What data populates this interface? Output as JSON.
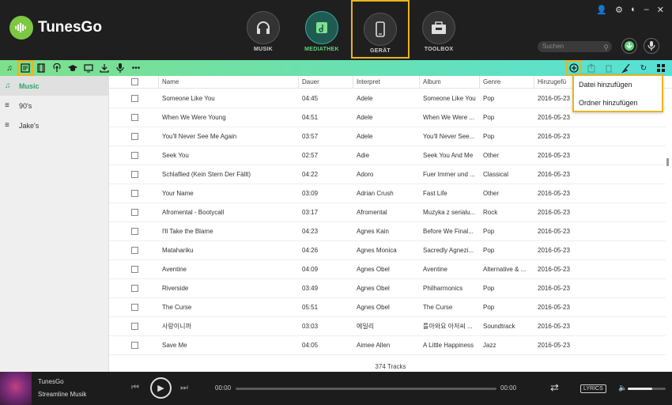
{
  "app": {
    "name": "TunesGo"
  },
  "window_controls": {
    "user": "👤",
    "settings": "⚙",
    "toggle": "◐",
    "minimize": "–",
    "close": "✕"
  },
  "nav_tabs": [
    {
      "label": "MUSIK"
    },
    {
      "label": "MEDIATHEK"
    },
    {
      "label": "GERÄT"
    },
    {
      "label": "TOOLBOX"
    }
  ],
  "search": {
    "placeholder": "Suchen"
  },
  "sidebar": {
    "items": [
      {
        "label": "Music"
      },
      {
        "label": "90's"
      },
      {
        "label": "Jake's"
      }
    ]
  },
  "table": {
    "headers": [
      "Name",
      "Dauer",
      "Interpret",
      "Album",
      "Genre",
      "Hinzugefü"
    ],
    "rows": [
      {
        "name": "Someone Like You",
        "duration": "04:45",
        "artist": "Adele",
        "album": "Someone Like You",
        "genre": "Pop",
        "added": "2016-05-23"
      },
      {
        "name": "When We Were Young",
        "duration": "04:51",
        "artist": "Adele",
        "album": "When We Were ...",
        "genre": "Pop",
        "added": "2016-05-23"
      },
      {
        "name": "You'll Never See Me Again",
        "duration": "03:57",
        "artist": "Adele",
        "album": "You'll Never See...",
        "genre": "Pop",
        "added": "2016-05-23"
      },
      {
        "name": "Seek You",
        "duration": "02:57",
        "artist": "Adie",
        "album": "Seek You And Me",
        "genre": "Other",
        "added": "2016-05-23"
      },
      {
        "name": "Schlaflied (Kein Stern Der Fällt)",
        "duration": "04:22",
        "artist": "Adoro",
        "album": "Fuer Immer und ...",
        "genre": "Classical",
        "added": "2016-05-23"
      },
      {
        "name": "Your Name",
        "duration": "03:09",
        "artist": "Adrian Crush",
        "album": "Fast Life",
        "genre": "Other",
        "added": "2016-05-23"
      },
      {
        "name": "Afromental - Bootycall",
        "duration": "03:17",
        "artist": "Afromental",
        "album": "Muzyka z serialu...",
        "genre": "Rock",
        "added": "2016-05-23"
      },
      {
        "name": "I'll Take the Blame",
        "duration": "04:23",
        "artist": "Agnes Kain",
        "album": "Before We Final...",
        "genre": "Pop",
        "added": "2016-05-23"
      },
      {
        "name": "Matahariku",
        "duration": "04:26",
        "artist": "Agnes Monica",
        "album": "Sacredly Agnezi...",
        "genre": "Pop",
        "added": "2016-05-23"
      },
      {
        "name": "Aventine",
        "duration": "04:09",
        "artist": "Agnes Obel",
        "album": "Aventine",
        "genre": "Alternative & ...",
        "added": "2016-05-23"
      },
      {
        "name": "Riverside",
        "duration": "03:49",
        "artist": "Agnes Obel",
        "album": "Philharmonics",
        "genre": "Pop",
        "added": "2016-05-23"
      },
      {
        "name": "The Curse",
        "duration": "05:51",
        "artist": "Agnes Obel",
        "album": "The Curse",
        "genre": "Pop",
        "added": "2016-05-23"
      },
      {
        "name": "사랑이니까",
        "duration": "03:03",
        "artist": "에일리",
        "album": "틀아와요 아저씨 ...",
        "genre": "Soundtrack",
        "added": "2016-05-23"
      },
      {
        "name": "Save Me",
        "duration": "04:05",
        "artist": "Aimee Allen",
        "album": "A Little Happiness",
        "genre": "Jazz",
        "added": "2016-05-23"
      }
    ]
  },
  "track_count": "374 Tracks",
  "dropdown": {
    "items": [
      {
        "label": "Datei hinzufügen"
      },
      {
        "label": "Ordner hinzufügen"
      }
    ]
  },
  "player": {
    "title": "TunesGo",
    "subtitle": "Streamline Musik",
    "time_current": "00:00",
    "time_total": "00:00",
    "progress": 0,
    "volume": 0.65,
    "lyrics_label": "LYRICS"
  },
  "colors": {
    "accent_green": "#5fd47a",
    "highlight": "#e8b51e",
    "toolbar_start": "#7ee08b",
    "toolbar_end": "#56e1d6"
  }
}
